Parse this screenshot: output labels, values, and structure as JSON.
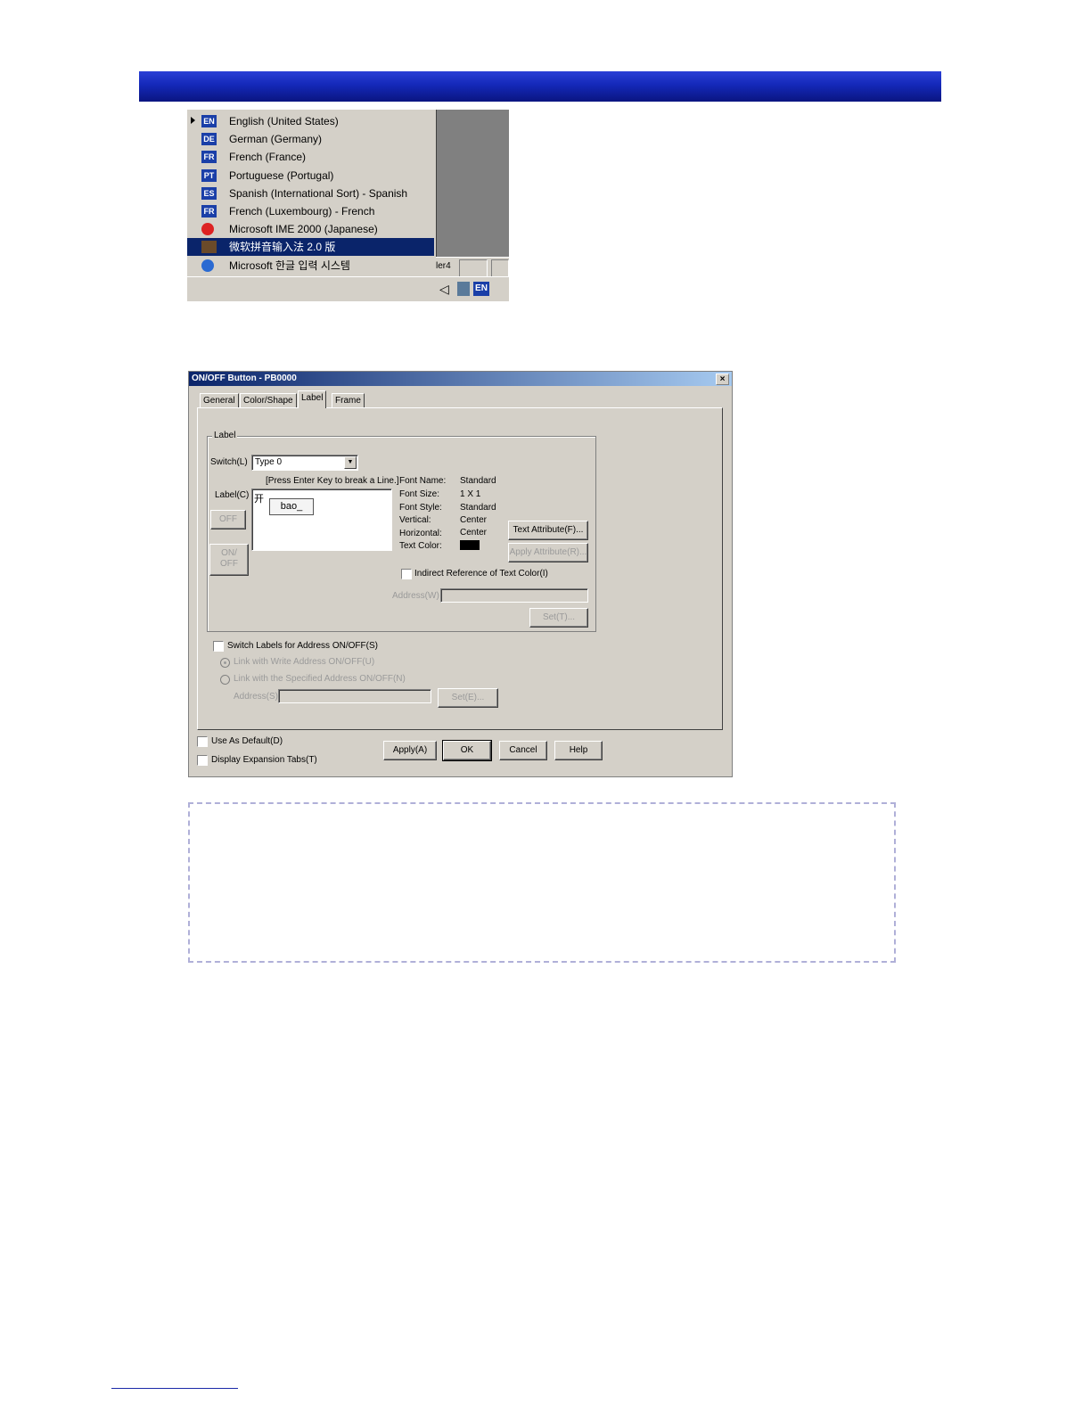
{
  "language_menu": {
    "items": [
      {
        "code": "EN",
        "label": "English (United States)",
        "checked": true
      },
      {
        "code": "DE",
        "label": "German (Germany)"
      },
      {
        "code": "FR",
        "label": "French (France)"
      },
      {
        "code": "PT",
        "label": "Portuguese (Portugal)"
      },
      {
        "code": "ES",
        "label": "Spanish (International Sort) - Spanish"
      },
      {
        "code": "FR",
        "label": "French (Luxembourg) - French"
      },
      {
        "code": "",
        "label": "Microsoft IME 2000 (Japanese)"
      },
      {
        "code": "",
        "label": "微软拼音输入法 2.0 版",
        "selected": true
      },
      {
        "code": "",
        "label": "Microsoft 한글 입력 시스템"
      }
    ],
    "taskbar_fragment": "ler4",
    "tray_lang": "EN"
  },
  "dialog": {
    "title": "ON/OFF Button - PB0000",
    "close": "×",
    "tabs": [
      "General",
      "Color/Shape",
      "Label",
      "Frame"
    ],
    "label_group": {
      "title": "Label",
      "switch_label": "Switch(L)",
      "switch_value": "Type 0",
      "hint": "[Press Enter Key to break a Line.]",
      "label_c": "Label(C)",
      "off_button": "OFF",
      "onoff_button": "ON/\nOFF",
      "ime_text": "bao_",
      "ime_cursor": "开",
      "font_name_label": "Font Name:",
      "font_name_value": "Standard",
      "font_size_label": "Font Size:",
      "font_size_value": "1 X 1",
      "font_style_label": "Font Style:",
      "font_style_value": "Standard",
      "vertical_label": "Vertical:",
      "vertical_value": "Center",
      "horizontal_label": "Horizontal:",
      "horizontal_value": "Center",
      "text_color_label": "Text Color:",
      "text_attr_button": "Text Attribute(F)...",
      "apply_attr_button": "Apply Attribute(R)...",
      "indirect_label": "Indirect Reference of Text Color(I)",
      "address_w_label": "Address(W)",
      "set_t_button": "Set(T)..."
    },
    "switch_labels_check": "Switch Labels for Address ON/OFF(S)",
    "radio_write": "Link with Write Address ON/OFF(U)",
    "radio_specified": "Link with the Specified Address ON/OFF(N)",
    "address_s_label": "Address(S)",
    "set_button": "Set(E)...",
    "use_default": "Use As Default(D)",
    "display_tabs": "Display Expansion Tabs(T)",
    "apply": "Apply(A)",
    "ok": "OK",
    "cancel": "Cancel",
    "help": "Help"
  }
}
